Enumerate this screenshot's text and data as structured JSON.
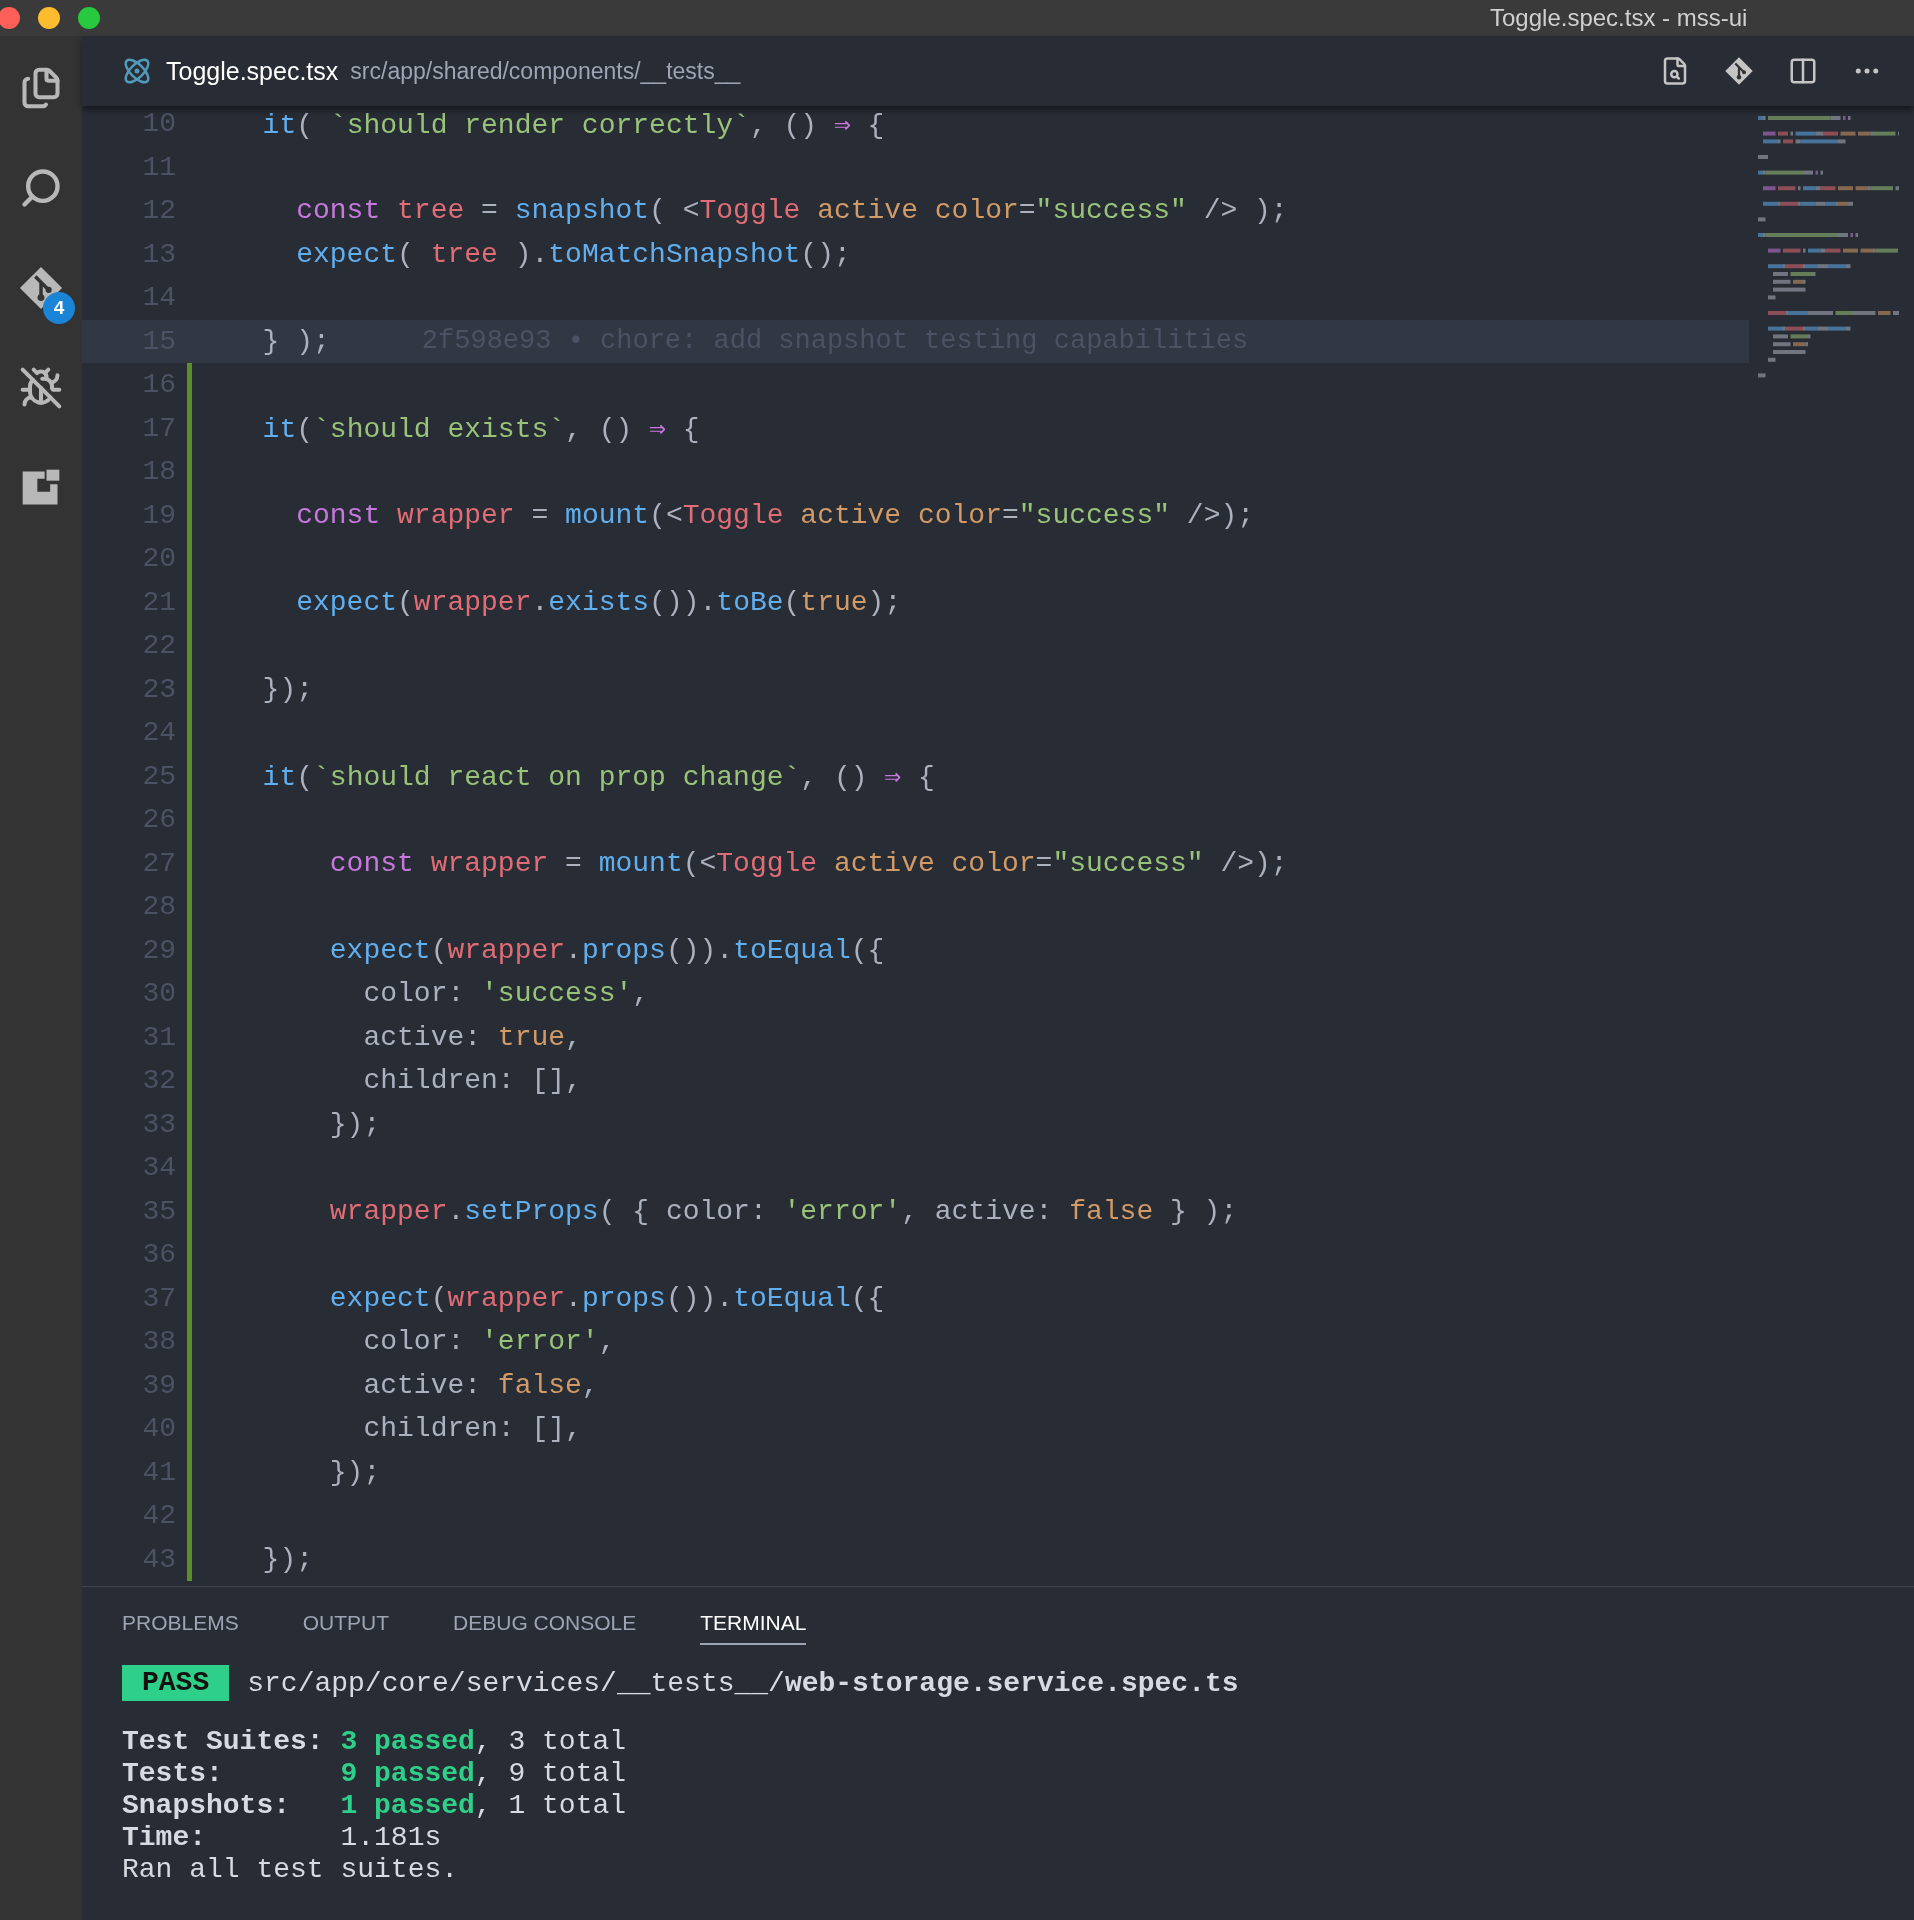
{
  "window": {
    "title": "Toggle.spec.tsx - mss-ui"
  },
  "activity_bar": [
    {
      "kind": "files"
    },
    {
      "kind": "search"
    },
    {
      "kind": "source_control",
      "badge": "4"
    },
    {
      "kind": "debug"
    },
    {
      "kind": "extensions"
    }
  ],
  "editor_tab": {
    "file": "Toggle.spec.tsx",
    "path": "src/app/shared/components/__tests__"
  },
  "toolbar": [
    {
      "kind": "open_preview"
    },
    {
      "kind": "git"
    },
    {
      "kind": "split"
    },
    {
      "kind": "more"
    }
  ],
  "editor": {
    "lines": [
      {
        "number": "10",
        "changed": false,
        "current": false,
        "tokens": [
          {
            "kind": "function",
            "text": "  it"
          },
          {
            "kind": "plain",
            "text": "( "
          },
          {
            "kind": "string",
            "text": "`should render correctly`"
          },
          {
            "kind": "plain",
            "text": ", () "
          },
          {
            "kind": "keyword",
            "text": "⇒"
          },
          {
            "kind": "plain",
            "text": " {"
          }
        ]
      },
      {
        "number": "11",
        "changed": false,
        "current": false
      },
      {
        "number": "12",
        "changed": false,
        "current": false,
        "tokens": [
          {
            "kind": "keyword",
            "text": "    const"
          },
          {
            "kind": "variable",
            "text": " tree"
          },
          {
            "kind": "plain",
            "text": " = "
          },
          {
            "kind": "function",
            "text": "snapshot"
          },
          {
            "kind": "plain",
            "text": "( <"
          },
          {
            "kind": "variable",
            "text": "Toggle"
          },
          {
            "kind": "attribute",
            "text": " active"
          },
          {
            "kind": "attribute",
            "text": " color"
          },
          {
            "kind": "plain",
            "text": "="
          },
          {
            "kind": "string",
            "text": "\"success\""
          },
          {
            "kind": "plain",
            "text": " /> );"
          }
        ]
      },
      {
        "number": "13",
        "changed": false,
        "current": false,
        "tokens": [
          {
            "kind": "function",
            "text": "    expect"
          },
          {
            "kind": "plain",
            "text": "( "
          },
          {
            "kind": "variable",
            "text": "tree"
          },
          {
            "kind": "plain",
            "text": " )."
          },
          {
            "kind": "function",
            "text": "toMatchSnapshot"
          },
          {
            "kind": "plain",
            "text": "();"
          }
        ]
      },
      {
        "number": "14",
        "changed": false,
        "current": false
      },
      {
        "number": "15",
        "changed": false,
        "current": true,
        "blame": "2f598e93 • chore: add snapshot testing capabilities",
        "tokens": [
          {
            "kind": "plain",
            "text": "  } );"
          }
        ]
      },
      {
        "number": "16",
        "changed": true,
        "current": false
      },
      {
        "number": "17",
        "changed": true,
        "current": false,
        "tokens": [
          {
            "kind": "function",
            "text": "  it"
          },
          {
            "kind": "plain",
            "text": "("
          },
          {
            "kind": "string",
            "text": "`should exists`"
          },
          {
            "kind": "plain",
            "text": ", () "
          },
          {
            "kind": "keyword",
            "text": "⇒"
          },
          {
            "kind": "plain",
            "text": " {"
          }
        ]
      },
      {
        "number": "18",
        "changed": true,
        "current": false
      },
      {
        "number": "19",
        "changed": true,
        "current": false,
        "tokens": [
          {
            "kind": "keyword",
            "text": "    const"
          },
          {
            "kind": "variable",
            "text": " wrapper"
          },
          {
            "kind": "plain",
            "text": " = "
          },
          {
            "kind": "function",
            "text": "mount"
          },
          {
            "kind": "plain",
            "text": "(<"
          },
          {
            "kind": "variable",
            "text": "Toggle"
          },
          {
            "kind": "attribute",
            "text": " active"
          },
          {
            "kind": "attribute",
            "text": " color"
          },
          {
            "kind": "plain",
            "text": "="
          },
          {
            "kind": "string",
            "text": "\"success\""
          },
          {
            "kind": "plain",
            "text": " />);"
          }
        ]
      },
      {
        "number": "20",
        "changed": true,
        "current": false
      },
      {
        "number": "21",
        "changed": true,
        "current": false,
        "tokens": [
          {
            "kind": "function",
            "text": "    expect"
          },
          {
            "kind": "plain",
            "text": "("
          },
          {
            "kind": "variable",
            "text": "wrapper"
          },
          {
            "kind": "plain",
            "text": "."
          },
          {
            "kind": "function",
            "text": "exists"
          },
          {
            "kind": "plain",
            "text": "())."
          },
          {
            "kind": "function",
            "text": "toBe"
          },
          {
            "kind": "plain",
            "text": "("
          },
          {
            "kind": "attribute",
            "text": "true"
          },
          {
            "kind": "plain",
            "text": ");"
          }
        ]
      },
      {
        "number": "22",
        "changed": true,
        "current": false
      },
      {
        "number": "23",
        "changed": true,
        "current": false,
        "tokens": [
          {
            "kind": "plain",
            "text": "  });"
          }
        ]
      },
      {
        "number": "24",
        "changed": true,
        "current": false
      },
      {
        "number": "25",
        "changed": true,
        "current": false,
        "tokens": [
          {
            "kind": "function",
            "text": "  it"
          },
          {
            "kind": "plain",
            "text": "("
          },
          {
            "kind": "string",
            "text": "`should react on prop change`"
          },
          {
            "kind": "plain",
            "text": ", () "
          },
          {
            "kind": "keyword",
            "text": "⇒"
          },
          {
            "kind": "plain",
            "text": " {"
          }
        ]
      },
      {
        "number": "26",
        "changed": true,
        "current": false
      },
      {
        "number": "27",
        "changed": true,
        "current": false,
        "tokens": [
          {
            "kind": "keyword",
            "text": "      const"
          },
          {
            "kind": "variable",
            "text": " wrapper"
          },
          {
            "kind": "plain",
            "text": " = "
          },
          {
            "kind": "function",
            "text": "mount"
          },
          {
            "kind": "plain",
            "text": "(<"
          },
          {
            "kind": "variable",
            "text": "Toggle"
          },
          {
            "kind": "attribute",
            "text": " active"
          },
          {
            "kind": "attribute",
            "text": " color"
          },
          {
            "kind": "plain",
            "text": "="
          },
          {
            "kind": "string",
            "text": "\"success\""
          },
          {
            "kind": "plain",
            "text": " />);"
          }
        ]
      },
      {
        "number": "28",
        "changed": true,
        "current": false
      },
      {
        "number": "29",
        "changed": true,
        "current": false,
        "tokens": [
          {
            "kind": "function",
            "text": "      expect"
          },
          {
            "kind": "plain",
            "text": "("
          },
          {
            "kind": "variable",
            "text": "wrapper"
          },
          {
            "kind": "plain",
            "text": "."
          },
          {
            "kind": "function",
            "text": "props"
          },
          {
            "kind": "plain",
            "text": "())."
          },
          {
            "kind": "function",
            "text": "toEqual"
          },
          {
            "kind": "plain",
            "text": "({"
          }
        ]
      },
      {
        "number": "30",
        "changed": true,
        "current": false,
        "tokens": [
          {
            "kind": "plain",
            "text": "        color: "
          },
          {
            "kind": "string",
            "text": "'success'"
          },
          {
            "kind": "plain",
            "text": ","
          }
        ]
      },
      {
        "number": "31",
        "changed": true,
        "current": false,
        "tokens": [
          {
            "kind": "plain",
            "text": "        active: "
          },
          {
            "kind": "attribute",
            "text": "true"
          },
          {
            "kind": "plain",
            "text": ","
          }
        ]
      },
      {
        "number": "32",
        "changed": true,
        "current": false,
        "tokens": [
          {
            "kind": "plain",
            "text": "        children: [],"
          }
        ]
      },
      {
        "number": "33",
        "changed": true,
        "current": false,
        "tokens": [
          {
            "kind": "plain",
            "text": "      });"
          }
        ]
      },
      {
        "number": "34",
        "changed": true,
        "current": false
      },
      {
        "number": "35",
        "changed": true,
        "current": false,
        "tokens": [
          {
            "kind": "variable",
            "text": "      wrapper"
          },
          {
            "kind": "plain",
            "text": "."
          },
          {
            "kind": "function",
            "text": "setProps"
          },
          {
            "kind": "plain",
            "text": "( { color: "
          },
          {
            "kind": "string",
            "text": "'error'"
          },
          {
            "kind": "plain",
            "text": ", active: "
          },
          {
            "kind": "attribute",
            "text": "false"
          },
          {
            "kind": "plain",
            "text": " } );"
          }
        ]
      },
      {
        "number": "36",
        "changed": true,
        "current": false
      },
      {
        "number": "37",
        "changed": true,
        "current": false,
        "tokens": [
          {
            "kind": "function",
            "text": "      expect"
          },
          {
            "kind": "plain",
            "text": "("
          },
          {
            "kind": "variable",
            "text": "wrapper"
          },
          {
            "kind": "plain",
            "text": "."
          },
          {
            "kind": "function",
            "text": "props"
          },
          {
            "kind": "plain",
            "text": "())."
          },
          {
            "kind": "function",
            "text": "toEqual"
          },
          {
            "kind": "plain",
            "text": "({"
          }
        ]
      },
      {
        "number": "38",
        "changed": true,
        "current": false,
        "tokens": [
          {
            "kind": "plain",
            "text": "        color: "
          },
          {
            "kind": "string",
            "text": "'error'"
          },
          {
            "kind": "plain",
            "text": ","
          }
        ]
      },
      {
        "number": "39",
        "changed": true,
        "current": false,
        "tokens": [
          {
            "kind": "plain",
            "text": "        active: "
          },
          {
            "kind": "attribute",
            "text": "false"
          },
          {
            "kind": "plain",
            "text": ","
          }
        ]
      },
      {
        "number": "40",
        "changed": true,
        "current": false,
        "tokens": [
          {
            "kind": "plain",
            "text": "        children: [],"
          }
        ]
      },
      {
        "number": "41",
        "changed": true,
        "current": false,
        "tokens": [
          {
            "kind": "plain",
            "text": "      });"
          }
        ]
      },
      {
        "number": "42",
        "changed": true,
        "current": false
      },
      {
        "number": "43",
        "changed": true,
        "current": false,
        "tokens": [
          {
            "kind": "plain",
            "text": "  });"
          }
        ]
      }
    ]
  },
  "panel_tabs": [
    {
      "label": "PROBLEMS",
      "selected": false
    },
    {
      "label": "OUTPUT",
      "selected": false
    },
    {
      "label": "DEBUG CONSOLE",
      "selected": false
    },
    {
      "label": "TERMINAL",
      "selected": true
    }
  ],
  "terminal": {
    "badge": "PASS",
    "path": "src/app/core/services/__tests__/**web-storage.service.spec.ts**",
    "summary": [
      {
        "kind": "count",
        "label": "Test Suites:",
        "passed": "3 passed",
        "total": ", 3 total"
      },
      {
        "kind": "count",
        "label": "Tests:",
        "passed": "9 passed",
        "total": ", 9 total"
      },
      {
        "kind": "count",
        "label": "Snapshots:",
        "passed": "1 passed",
        "total": ", 1 total"
      },
      {
        "kind": "value",
        "label": "Time:",
        "value": "1.181s"
      },
      {
        "kind": "plain",
        "text": "Ran all test suites."
      }
    ]
  }
}
